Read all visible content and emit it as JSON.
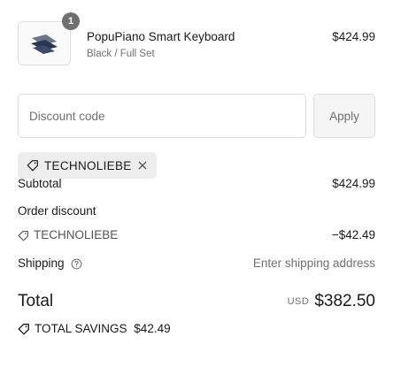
{
  "product": {
    "quantity": "1",
    "name": "PopuPiano Smart Keyboard",
    "variant": "Black / Full Set",
    "price": "$424.99",
    "thumbnail_icon": "keyboard-thumbnail-icon"
  },
  "discount": {
    "placeholder": "Discount code",
    "apply_label": "Apply",
    "applied_code": "TECHNOLIEBE"
  },
  "summary": {
    "subtotal_label": "Subtotal",
    "subtotal_value": "$424.99",
    "order_discount_label": "Order discount",
    "order_discount_code": "TECHNOLIEBE",
    "order_discount_value": "−$42.49",
    "shipping_label": "Shipping",
    "shipping_value": "Enter shipping address",
    "total_label": "Total",
    "currency": "USD",
    "total_value": "$382.50",
    "savings_label": "TOTAL SAVINGS",
    "savings_value": "$42.49"
  },
  "colors": {
    "text": "#1a1a1a",
    "muted": "#707070",
    "border": "#dedede",
    "tag_background": "#ededed"
  }
}
